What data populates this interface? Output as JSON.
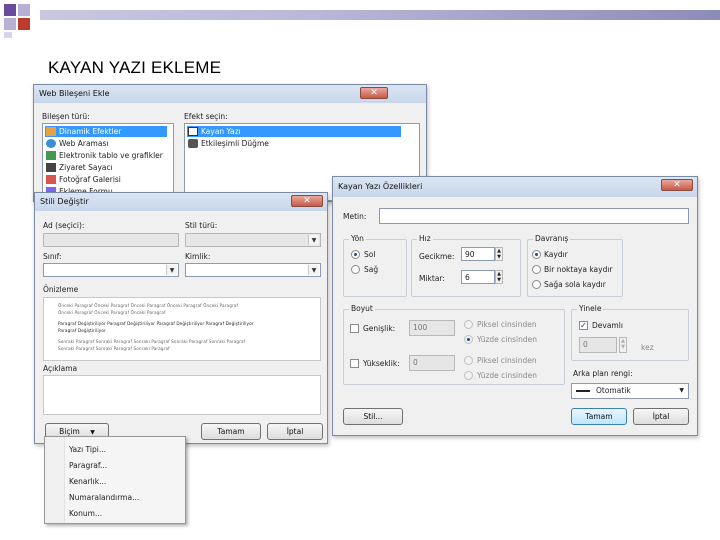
{
  "slide": {
    "title": "KAYAN YAZI EKLEME"
  },
  "web_component_dialog": {
    "title": "Web Bileşeni Ekle",
    "component_type_label": "Bileşen türü:",
    "component_types": [
      "Dinamik Efektler",
      "Web Araması",
      "Elektronik tablo ve grafikler",
      "Ziyaret Sayacı",
      "Fotoğraf Galerisi",
      "Ekleme Formu"
    ],
    "effect_label": "Efekt seçin:",
    "effects": [
      "Kayan Yazı",
      "Etkileşimli Düğme"
    ]
  },
  "style_dialog": {
    "title": "Stili Değiştir",
    "name_label": "Ad (seçici):",
    "style_type_label": "Stil türü:",
    "class_label": "Sınıf:",
    "id_label": "Kimlik:",
    "preview_label": "Önizleme",
    "preview_lines": [
      "Önceki Paragraf Önceki Paragraf Önceki Paragraf Önceki Paragraf Önceki Paragraf",
      "Önceki Paragraf Önceki Paragraf Önceki Paragraf",
      "Paragraf Değiştiriliyor Paragraf Değiştiriliyor Paragraf Değiştiriliyor Paragraf Değiştiriliyor",
      "Paragraf Değiştiriliyor",
      "Sonraki Paragraf Sonraki Paragraf Sonraki Paragraf Sonraki Paragraf Sonraki Paragraf",
      "Sonraki Paragraf Sonraki Paragraf Sonraki Paragraf"
    ],
    "description_label": "Açıklama",
    "format_button": "Biçim",
    "format_arrow": "▼",
    "ok_button": "Tamam",
    "cancel_button": "İptal"
  },
  "format_menu": {
    "items": [
      "Yazı Tipi...",
      "Paragraf...",
      "Kenarlık...",
      "Numaralandırma...",
      "Konum..."
    ]
  },
  "marquee_dialog": {
    "title": "Kayan Yazı Özellikleri",
    "text_label": "Metin:",
    "text_value": "",
    "direction": {
      "label": "Yön",
      "options": [
        "Sol",
        "Sağ"
      ],
      "selected": 0
    },
    "speed": {
      "label": "Hız",
      "delay_label": "Gecikme:",
      "delay_value": "90",
      "amount_label": "Miktar:",
      "amount_value": "6"
    },
    "behavior": {
      "label": "Davranış",
      "options": [
        "Kaydır",
        "Bir noktaya kaydır",
        "Sağa sola kaydır"
      ],
      "selected": 0
    },
    "size": {
      "label": "Boyut",
      "width_label": "Genişlik:",
      "width_value": "100",
      "height_label": "Yükseklik:",
      "height_value": "0",
      "pixel_label": "Piksel cinsinden",
      "percent_label": "Yüzde cinsinden"
    },
    "repeat": {
      "label": "Yinele",
      "continuous_label": "Devamlı",
      "count_value": "0",
      "unit": "kez"
    },
    "background": {
      "label": "Arka plan rengi:",
      "value": "Otomatik"
    },
    "style_button": "Stil...",
    "ok_button": "Tamam",
    "cancel_button": "İptal"
  },
  "colors": {
    "selection": "#3399ff",
    "deco_red": "#c0392b",
    "deco_purple": "#6a4c9c"
  }
}
